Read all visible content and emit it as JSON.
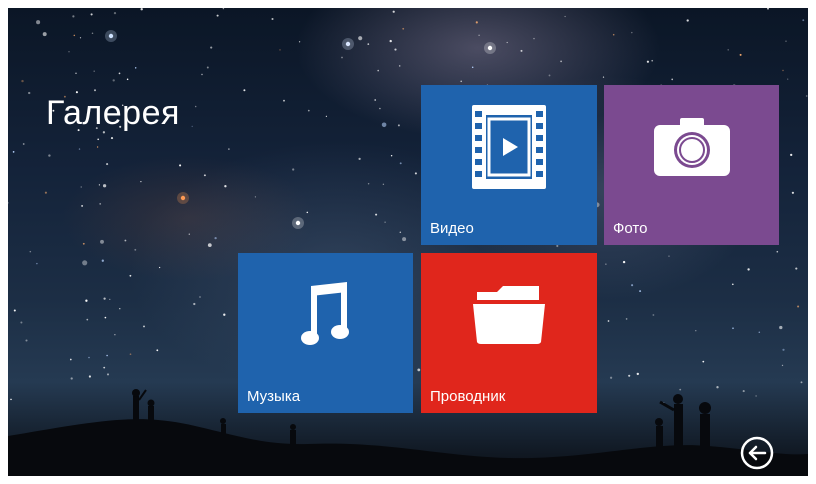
{
  "header": {
    "title": "Галерея"
  },
  "tiles": [
    {
      "id": "video",
      "label": "Видео",
      "icon": "film-play-icon",
      "color": "#1f63ad"
    },
    {
      "id": "photo",
      "label": "Фото",
      "icon": "camera-icon",
      "color": "#7b4a90"
    },
    {
      "id": "music",
      "label": "Музыка",
      "icon": "music-note-icon",
      "color": "#1f63ad"
    },
    {
      "id": "explorer",
      "label": "Проводник",
      "icon": "folder-icon",
      "color": "#e0261c"
    }
  ],
  "footer": {
    "back_icon": "back-arrow-icon"
  }
}
